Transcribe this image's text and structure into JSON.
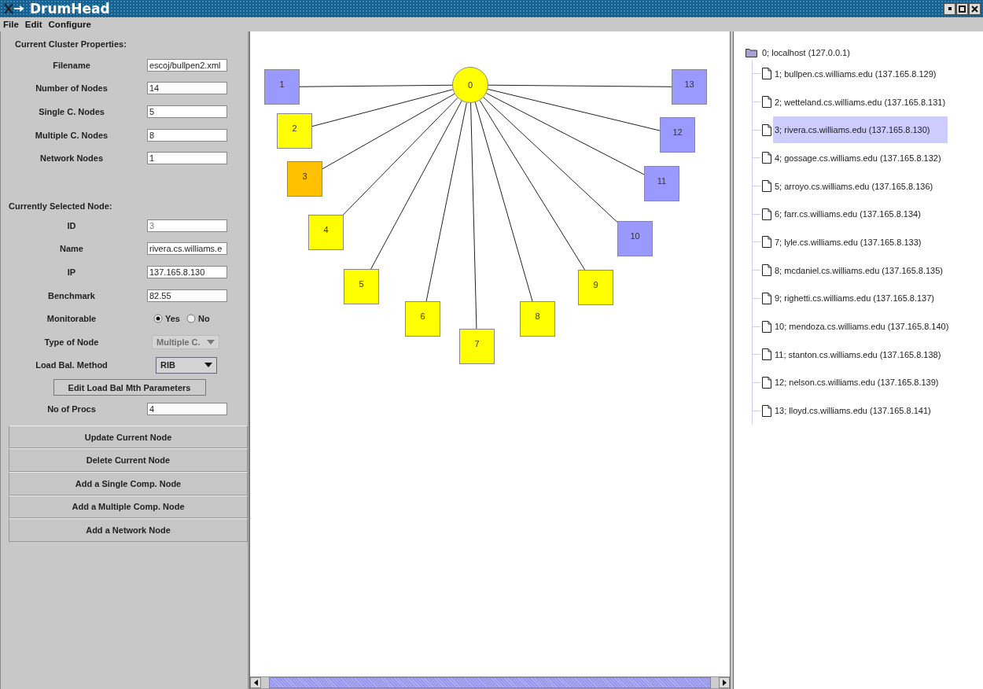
{
  "window": {
    "title": "DrumHead"
  },
  "menu": [
    "File",
    "Edit",
    "Configure"
  ],
  "cluster_properties": {
    "heading": "Current Cluster Properties:",
    "fields": [
      {
        "label": "Filename",
        "value": "escoj/bullpen2.xml"
      },
      {
        "label": "Number of Nodes",
        "value": "14"
      },
      {
        "label": "Single C. Nodes",
        "value": "5"
      },
      {
        "label": "Multiple C. Nodes",
        "value": "8"
      },
      {
        "label": "Network Nodes",
        "value": "1"
      }
    ]
  },
  "selected_node": {
    "heading": "Currently Selected Node:",
    "fields": [
      {
        "kind": "text",
        "label": "ID",
        "value": "3",
        "disabled": true
      },
      {
        "kind": "text",
        "label": "Name",
        "value": "rivera.cs.williams.e",
        "disabled": false
      },
      {
        "kind": "text",
        "label": "IP",
        "value": "137.165.8.130",
        "disabled": false
      },
      {
        "kind": "text",
        "label": "Benchmark",
        "value": "82.55",
        "disabled": false
      },
      {
        "kind": "radio",
        "label": "Monitorable",
        "options": [
          {
            "label": "Yes",
            "selected": true
          },
          {
            "label": "No",
            "selected": false
          }
        ]
      },
      {
        "kind": "dropdown",
        "label": "Type of Node",
        "value": "Multiple C.",
        "disabled": true
      },
      {
        "kind": "dropdown",
        "label": "Load Bal. Method",
        "value": "RIB",
        "disabled": false
      },
      {
        "kind": "button",
        "label": "Edit Load Bal Mth Parameters"
      },
      {
        "kind": "text",
        "label": "No of Procs",
        "value": "4",
        "disabled": false
      }
    ]
  },
  "actions": [
    "Update Current Node",
    "Delete Current Node",
    "Add a Single Comp. Node",
    "Add a Multiple Comp. Node",
    "Add a Network Node"
  ],
  "graph": {
    "nodes": [
      {
        "label": "1",
        "kind": "single",
        "selected": false
      },
      {
        "label": "0",
        "kind": "network",
        "selected": false
      },
      {
        "label": "13",
        "kind": "single",
        "selected": false
      },
      {
        "label": "2",
        "kind": "multiple",
        "selected": false
      },
      {
        "label": "12",
        "kind": "single",
        "selected": false
      },
      {
        "label": "3",
        "kind": "multiple",
        "selected": true
      },
      {
        "label": "11",
        "kind": "single",
        "selected": false
      },
      {
        "label": "4",
        "kind": "multiple",
        "selected": false
      },
      {
        "label": "10",
        "kind": "single",
        "selected": false
      },
      {
        "label": "5",
        "kind": "multiple",
        "selected": false
      },
      {
        "label": "9",
        "kind": "multiple",
        "selected": false
      },
      {
        "label": "6",
        "kind": "multiple",
        "selected": false
      },
      {
        "label": "8",
        "kind": "multiple",
        "selected": false
      },
      {
        "label": "7",
        "kind": "multiple",
        "selected": false
      }
    ]
  },
  "tree": {
    "root": {
      "label": "0; localhost (127.0.0.1)",
      "selected": false,
      "children": [
        {
          "label": "1; bullpen.cs.williams.edu (137.165.8.129)",
          "selected": false
        },
        {
          "label": "2; wetteland.cs.williams.edu (137.165.8.131)",
          "selected": false
        },
        {
          "label": "3; rivera.cs.williams.edu (137.165.8.130)",
          "selected": true
        },
        {
          "label": "4; gossage.cs.williams.edu (137.165.8.132)",
          "selected": false
        },
        {
          "label": "5; arroyo.cs.williams.edu (137.165.8.136)",
          "selected": false
        },
        {
          "label": "6; farr.cs.williams.edu (137.165.8.134)",
          "selected": false
        },
        {
          "label": "7; lyle.cs.williams.edu (137.165.8.133)",
          "selected": false
        },
        {
          "label": "8; mcdaniel.cs.williams.edu (137.165.8.135)",
          "selected": false
        },
        {
          "label": "9; righetti.cs.williams.edu (137.165.8.137)",
          "selected": false
        },
        {
          "label": "10; mendoza.cs.williams.edu (137.165.8.140)",
          "selected": false
        },
        {
          "label": "11; stanton.cs.williams.edu (137.165.8.138)",
          "selected": false
        },
        {
          "label": "12; nelson.cs.williams.edu (137.165.8.139)",
          "selected": false
        },
        {
          "label": "13; lloyd.cs.williams.edu (137.165.8.141)",
          "selected": false
        }
      ]
    }
  }
}
